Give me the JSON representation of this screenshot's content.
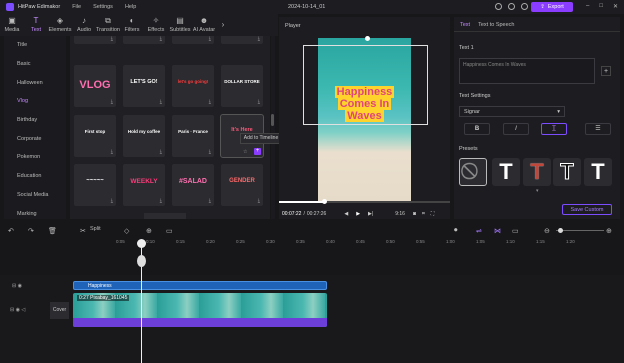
{
  "app": {
    "name": "HitPaw Edimakor",
    "project_title": "2024-10-14_01",
    "export_label": "Export"
  },
  "menu": [
    "File",
    "Settings",
    "Help"
  ],
  "toolbar": [
    {
      "label": "Media",
      "icon": "media-icon"
    },
    {
      "label": "Text",
      "icon": "text-icon"
    },
    {
      "label": "Elements",
      "icon": "elements-icon"
    },
    {
      "label": "Audio",
      "icon": "audio-icon"
    },
    {
      "label": "Transition",
      "icon": "transition-icon"
    },
    {
      "label": "Filters",
      "icon": "filters-icon"
    },
    {
      "label": "Effects",
      "icon": "effects-icon"
    },
    {
      "label": "Subtitles",
      "icon": "subtitles-icon"
    },
    {
      "label": "AI Avatar",
      "icon": "ai-avatar-icon"
    }
  ],
  "sidebar": [
    "Title",
    "Basic",
    "Halloween",
    "Vlog",
    "Birthday",
    "Corporate",
    "Pokemon",
    "Education",
    "Social Media",
    "Marking"
  ],
  "tiles": [
    {
      "text": "VLOG",
      "color": "#ff6fb0"
    },
    {
      "text": "LET'S GO!",
      "color": "#ffffff"
    },
    {
      "text": "let's go going!",
      "color": "#ff3b3b"
    },
    {
      "text": "DOLLAR STORE",
      "color": "#ffffff"
    },
    {
      "text": "First stop",
      "color": "#ffffff"
    },
    {
      "text": "Hold my coffee",
      "color": "#ffffff"
    },
    {
      "text": "Paris · France",
      "color": "#ffffff"
    },
    {
      "text": "It's Here",
      "color": "#ff5a7a"
    },
    {
      "text": "~~~~~",
      "color": "#ffffff"
    },
    {
      "text": "WEEKLY",
      "color": "#ff3b7a"
    },
    {
      "text": "#SALAD",
      "color": "#ff6fb0"
    },
    {
      "text": "GENDER",
      "color": "#ff6a6a"
    }
  ],
  "tooltip": "Add to Timeline",
  "player": {
    "label": "Player",
    "headline": [
      "Happiness",
      "Comes In",
      "Waves"
    ],
    "time_current": "00:07:22",
    "time_total": "00:27:26",
    "aspect": "9:16"
  },
  "right": {
    "tab_text": "Text",
    "tab_tts": "Text to Speech",
    "text1_label": "Text 1",
    "text1_value": "Happiness Comes In Waves",
    "settings_label": "Text Settings",
    "font": "Signar",
    "presets_label": "Presets",
    "save_custom": "Save Custom"
  },
  "timeline": {
    "split": "Split",
    "ticks": [
      "0:05",
      "0:10",
      "0:15",
      "0:20",
      "0:25",
      "0:30",
      "0:35",
      "0:40",
      "0:45",
      "0:50",
      "0:55",
      "1:00",
      "1:05",
      "1:10",
      "1:15",
      "1:20"
    ],
    "text_clip": "Happiness",
    "video_clip": "0:27  Pixabay_161045",
    "cover": "Cover"
  },
  "colors": {
    "accent": "#8a3cff",
    "accent_text": "#c58bff",
    "headline_pink": "#e0457b",
    "headline_yellow": "#ffd22c"
  }
}
